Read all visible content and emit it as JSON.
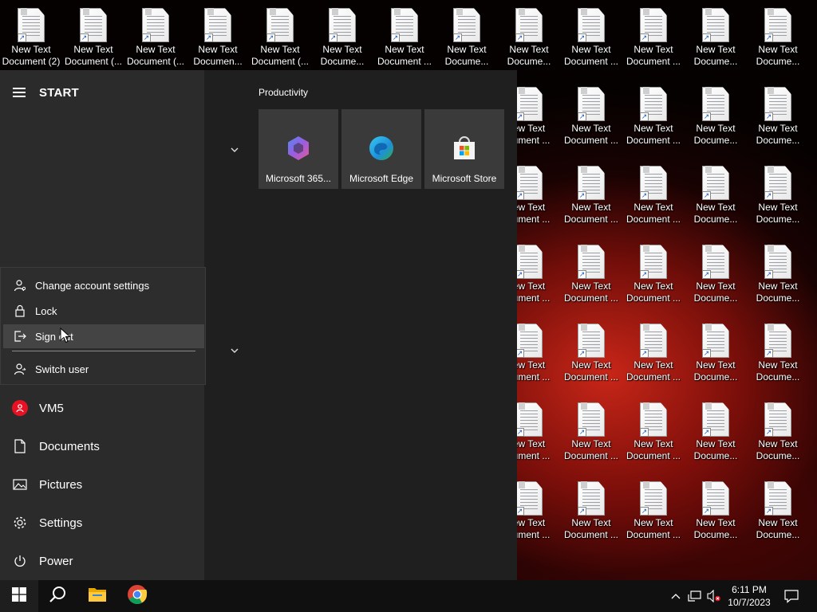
{
  "desktop": {
    "row0_labels": [
      [
        "New Text",
        "Document (2)"
      ],
      [
        "New Text",
        "Document (..."
      ],
      [
        "New Text",
        "Document (..."
      ],
      [
        "New Text",
        "Documen..."
      ],
      [
        "New Text",
        "Document (..."
      ],
      [
        "New Text",
        "Docume..."
      ],
      [
        "New Text",
        "Document ..."
      ],
      [
        "New Text",
        "Docume..."
      ],
      [
        "New Text",
        "Docume..."
      ],
      [
        "New Text",
        "Document ..."
      ],
      [
        "New Text",
        "Document ..."
      ],
      [
        "New Text",
        "Docume..."
      ],
      [
        "New Text",
        "Docume..."
      ]
    ],
    "grid_labels": [
      [
        "ew Text",
        "cument ..."
      ],
      [
        "New Text",
        "Document ..."
      ],
      [
        "New Text",
        "Document ..."
      ],
      [
        "New Text",
        "Docume..."
      ],
      [
        "New Text",
        "Docume..."
      ]
    ]
  },
  "start_menu": {
    "title": "START",
    "group_label": "Productivity",
    "tiles": [
      {
        "label": "Microsoft 365...",
        "icon": "microsoft-365-icon"
      },
      {
        "label": "Microsoft Edge",
        "icon": "edge-icon"
      },
      {
        "label": "Microsoft Store",
        "icon": "store-icon"
      }
    ],
    "account_menu": {
      "change_settings": "Change account settings",
      "lock": "Lock",
      "sign_out": "Sign out",
      "switch_user": "Switch user"
    },
    "rail": {
      "user": "VM5",
      "documents": "Documents",
      "pictures": "Pictures",
      "settings": "Settings",
      "power": "Power"
    }
  },
  "taskbar": {
    "time": "6:11 PM",
    "date": "10/7/2023",
    "pinned": [
      "file-explorer-icon",
      "chrome-icon"
    ]
  },
  "colors": {
    "start_bg": "#1f1f1f",
    "rail_bg": "#2b2b2b",
    "tile_bg": "#3a3a3a",
    "taskbar_bg": "#101010",
    "avatar": "#e81123"
  }
}
